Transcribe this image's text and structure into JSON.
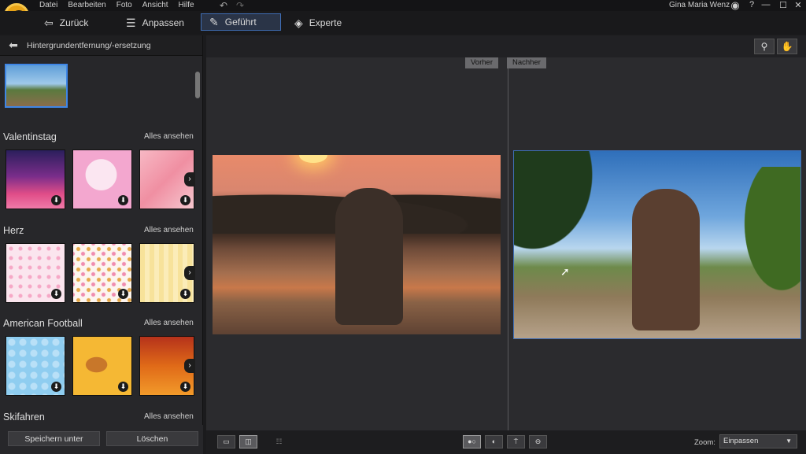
{
  "menu": [
    "Datei",
    "Bearbeiten",
    "Foto",
    "Ansicht",
    "Hilfe"
  ],
  "user": "Gina Maria Wenz",
  "toolbar": {
    "back": "Zurück",
    "adjust": "Anpassen",
    "guided": "Geführt",
    "expert": "Experte"
  },
  "sidebar": {
    "title": "Hintergrundentfernung/-ersetzung",
    "categories": [
      {
        "name": "Valentinstag",
        "link": "Alles ansehen"
      },
      {
        "name": "Herz",
        "link": "Alles ansehen"
      },
      {
        "name": "American Football",
        "link": "Alles ansehen"
      },
      {
        "name": "Skifahren",
        "link": "Alles ansehen"
      }
    ],
    "save": "Speichern unter",
    "delete": "Löschen"
  },
  "view": {
    "before": "Vorher",
    "after": "Nachher"
  },
  "zoom": {
    "label": "Zoom:",
    "value": "Einpassen"
  },
  "icons": [
    "logo-icon",
    "undo-icon",
    "redo-icon",
    "user-icon",
    "help-icon",
    "minimize-icon",
    "maximize-icon",
    "close-icon",
    "back-arrow-icon",
    "sliders-icon",
    "magic-wand-icon",
    "layers-icon",
    "zoom-icon",
    "hand-icon",
    "download-icon",
    "chevron-right-icon"
  ],
  "colors": {
    "accent": "#3f86e6",
    "background": "#1b1b1d",
    "panel": "#27272a"
  }
}
